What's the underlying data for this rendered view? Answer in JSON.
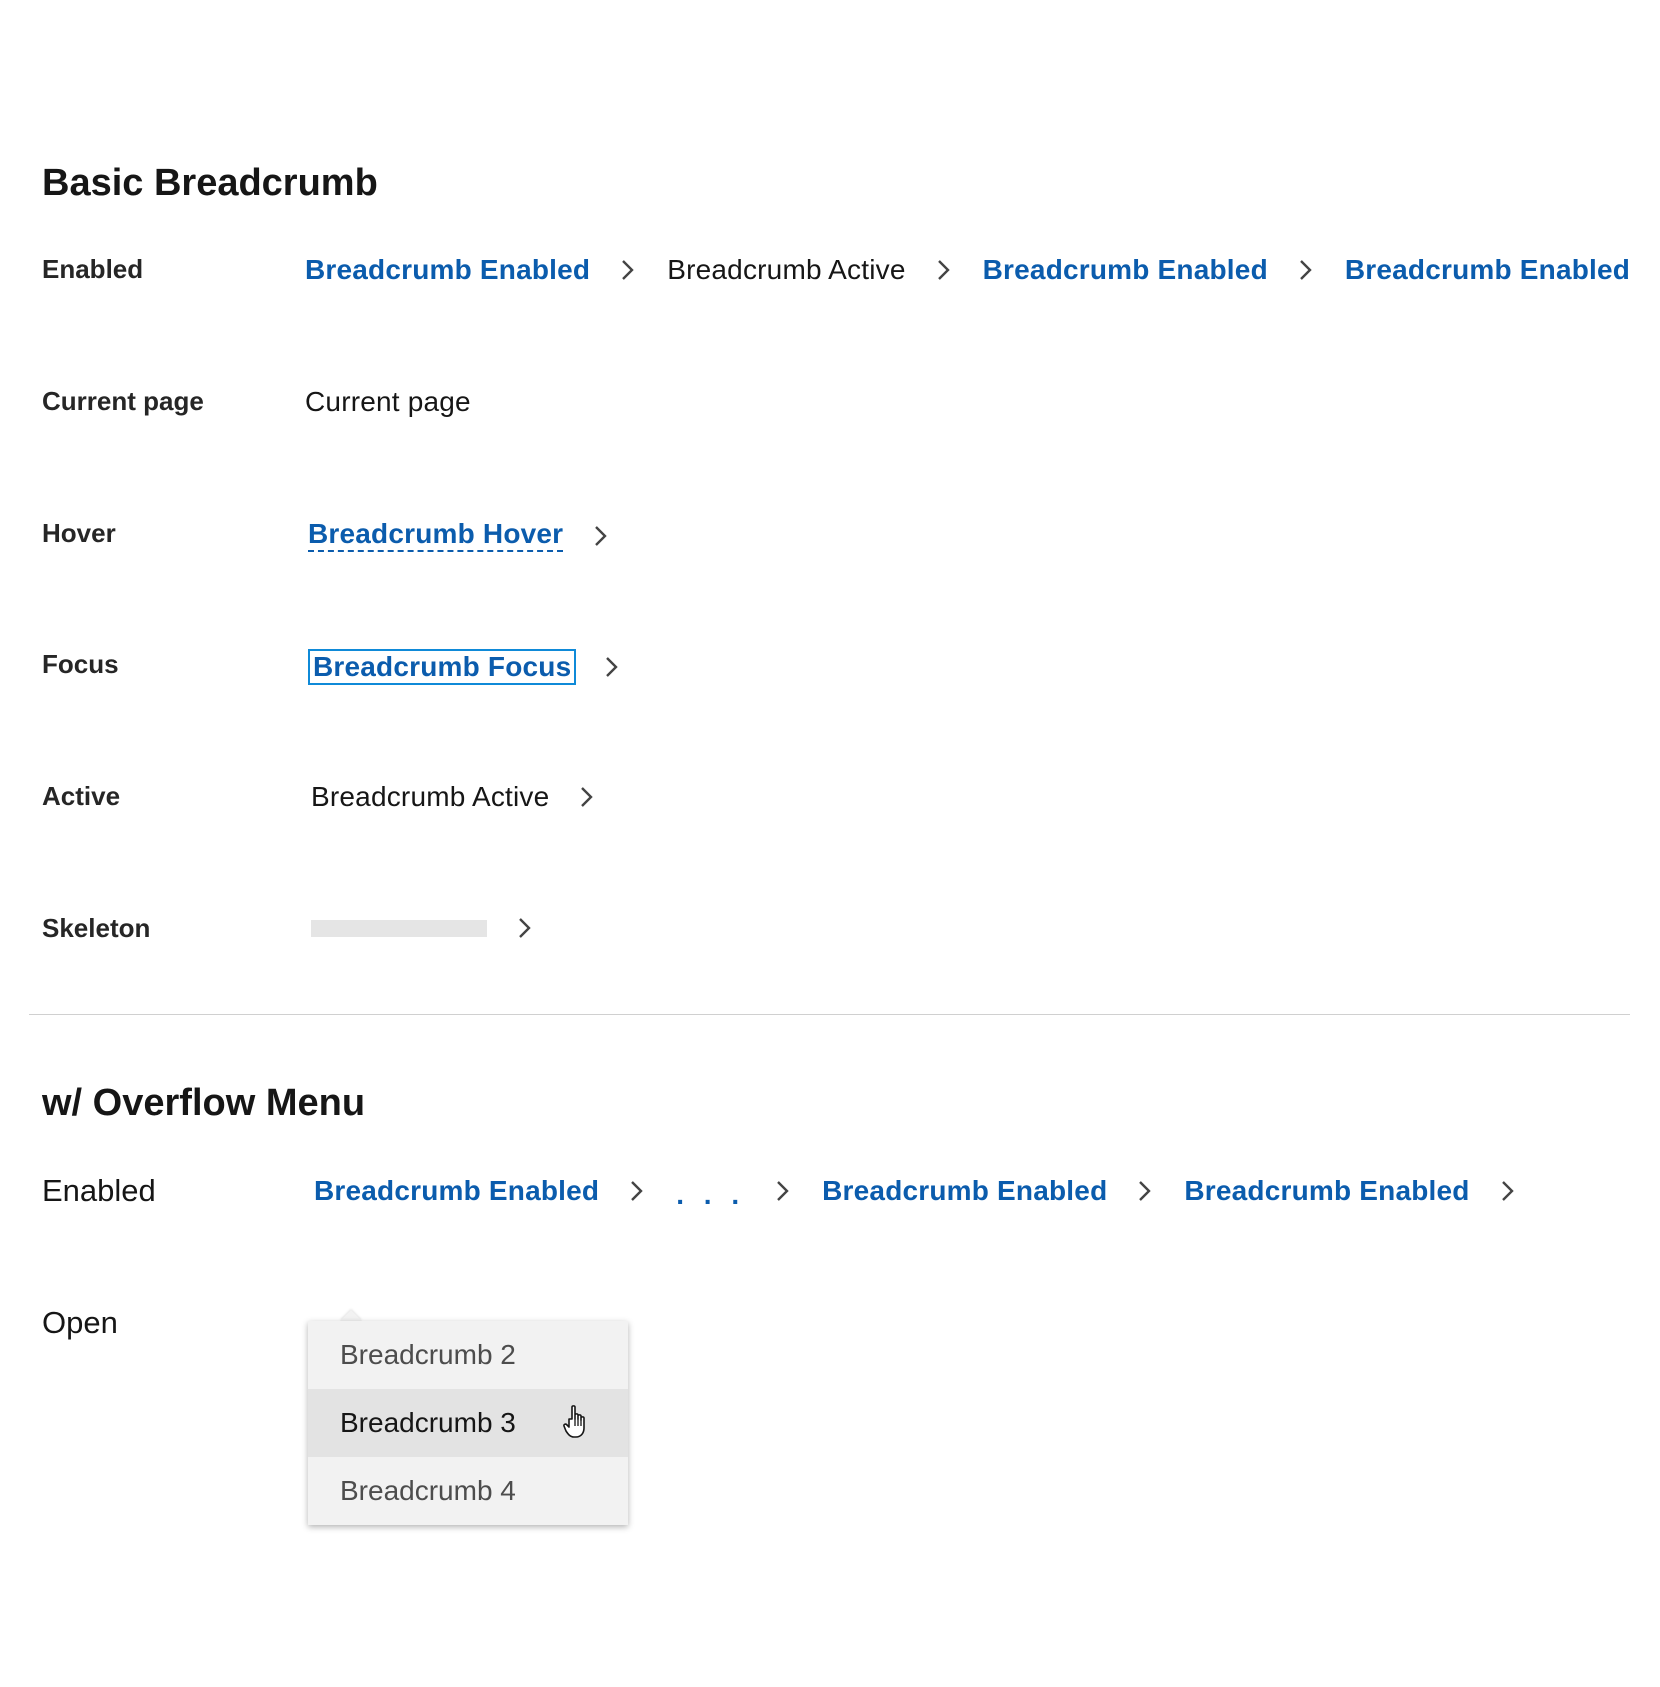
{
  "basic": {
    "title": "Basic Breadcrumb",
    "rows": {
      "enabled": {
        "label": "Enabled",
        "items": [
          "Breadcrumb Enabled",
          "Breadcrumb Active",
          "Breadcrumb Enabled",
          "Breadcrumb Enabled"
        ]
      },
      "current": {
        "label": "Current page",
        "item": "Current page"
      },
      "hover": {
        "label": "Hover",
        "item": "Breadcrumb Hover"
      },
      "focus": {
        "label": "Focus",
        "item": "Breadcrumb Focus"
      },
      "active": {
        "label": "Active",
        "item": "Breadcrumb Active"
      },
      "skeleton": {
        "label": "Skeleton"
      }
    }
  },
  "overflow": {
    "title": "w/ Overflow Menu",
    "rows": {
      "enabled": {
        "label": "Enabled",
        "items": [
          "Breadcrumb Enabled",
          ". . .",
          "Breadcrumb Enabled",
          "Breadcrumb Enabled"
        ]
      },
      "open": {
        "label": "Open",
        "menu_items": [
          "Breadcrumb 2",
          "Breadcrumb 3",
          "Breadcrumb 4"
        ],
        "hovered_index": 1
      }
    }
  },
  "icons": {
    "separator": "chevron-right-icon",
    "cursor": "hand-pointer-icon"
  },
  "colors": {
    "link": "#0b5cad",
    "focus_outline": "#0f8ad8",
    "skeleton": "#e5e5e5",
    "menu_bg": "#f2f2f2",
    "menu_hover": "#e3e3e3"
  }
}
